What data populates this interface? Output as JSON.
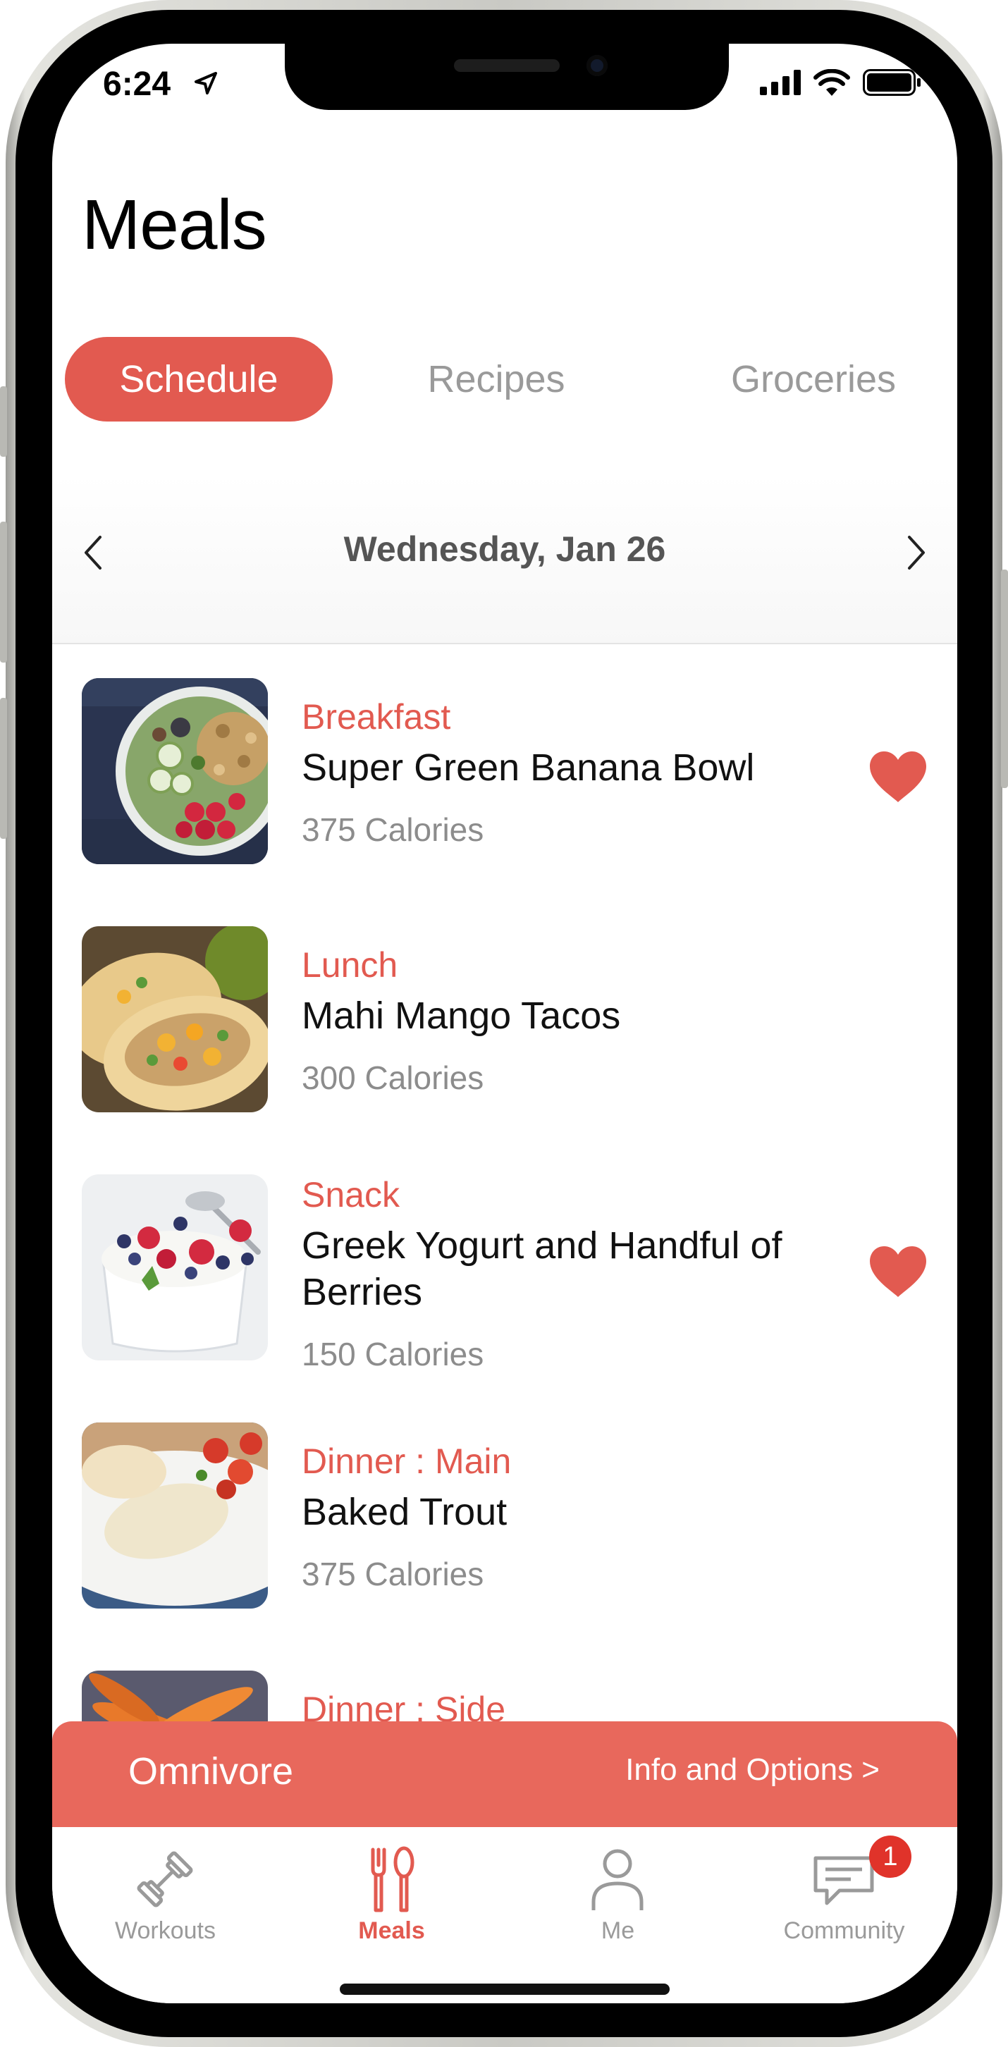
{
  "status": {
    "time": "6:24"
  },
  "header": {
    "title": "Meals"
  },
  "tabs": [
    {
      "label": "Schedule",
      "active": true
    },
    {
      "label": "Recipes",
      "active": false
    },
    {
      "label": "Groceries",
      "active": false
    }
  ],
  "date_nav": {
    "label": "Wednesday, Jan 26"
  },
  "meals": [
    {
      "type": "Breakfast",
      "name": "Super Green Banana Bowl",
      "calories": "375 Calories",
      "favorite": true
    },
    {
      "type": "Lunch",
      "name": "Mahi Mango Tacos",
      "calories": "300 Calories",
      "favorite": false
    },
    {
      "type": "Snack",
      "name": "Greek Yogurt and Handful of Berries",
      "calories": "150 Calories",
      "favorite": true
    },
    {
      "type": "Dinner : Main",
      "name": "Baked Trout",
      "calories": "375 Calories",
      "favorite": false
    },
    {
      "type": "Dinner : Side"
    }
  ],
  "plan_bar": {
    "name": "Omnivore",
    "options": "Info and Options >"
  },
  "tabbar": [
    {
      "label": "Workouts",
      "icon": "dumbbell-icon"
    },
    {
      "label": "Meals",
      "icon": "fork-spoon-icon",
      "active": true
    },
    {
      "label": "Me",
      "icon": "person-icon"
    },
    {
      "label": "Community",
      "icon": "chat-bubble-icon",
      "badge": "1"
    }
  ],
  "colors": {
    "accent": "#e25a50",
    "plan_bar": "#e8685c",
    "badge": "#e0332a",
    "muted": "#9a9a9a"
  }
}
